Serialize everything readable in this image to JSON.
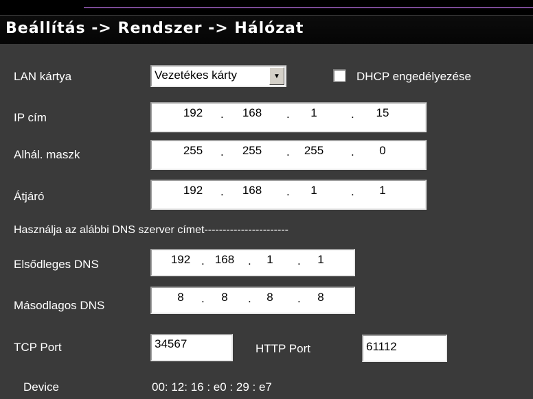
{
  "title": "Beállítás -> Rendszer -> Hálózat",
  "lan_card": {
    "label": "LAN kártya",
    "value": "Vezetékes kárty"
  },
  "dhcp": {
    "label": "DHCP engedélyezése",
    "checked": false
  },
  "ip": {
    "label": "IP cím",
    "octets": [
      "192",
      "168",
      "1",
      "15"
    ]
  },
  "mask": {
    "label": "Alhál. maszk",
    "octets": [
      "255",
      "255",
      "255",
      "0"
    ]
  },
  "gateway": {
    "label": "Átjáró",
    "octets": [
      "192",
      "168",
      "1",
      "1"
    ]
  },
  "dns_heading": "Használja az alábbi DNS szerver címet-----------------------",
  "primary_dns": {
    "label": "Elsődleges DNS",
    "octets": [
      "192",
      "168",
      "1",
      "1"
    ]
  },
  "secondary_dns": {
    "label": "Másodlagos DNS",
    "octets": [
      "8",
      "8",
      "8",
      "8"
    ]
  },
  "tcp_port": {
    "label": "TCP Port",
    "value": "34567"
  },
  "http_port": {
    "label": "HTTP Port",
    "value": "61112"
  },
  "device": {
    "label": "Device",
    "value": "00: 12: 16 : e0 : 29 : e7"
  },
  "colors": {
    "panel": "#3a3a3a",
    "titlebar": "#0a0a0a",
    "accent": "#7b4a96"
  }
}
